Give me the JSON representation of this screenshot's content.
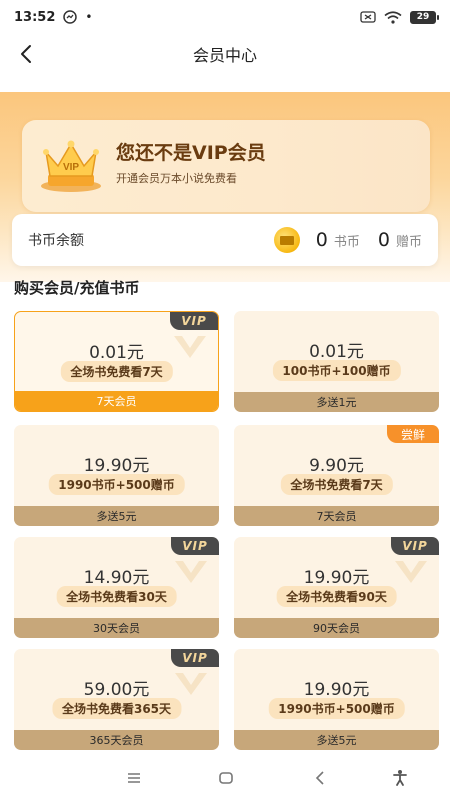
{
  "status_bar": {
    "time": "13:52",
    "dot": "•",
    "battery": "29",
    "icons": [
      "messenger-icon",
      "sim-icon",
      "wifi-icon",
      "battery-icon"
    ]
  },
  "nav": {
    "title": "会员中心",
    "back_icon": "chevron-left-icon"
  },
  "vip_banner": {
    "title": "您还不是VIP会员",
    "subtitle": "开通会员万本小说免费看",
    "crown_text": "VIP"
  },
  "balance": {
    "label": "书币余额",
    "coins": "0",
    "coins_unit": "书币",
    "gift": "0",
    "gift_unit": "赠币"
  },
  "section_title": "购买会员/充值书币",
  "products": [
    {
      "price": "0.01元",
      "desc": "全场书免费看7天",
      "footer": "7天会员",
      "tag": "VIP",
      "selected": true
    },
    {
      "price": "0.01元",
      "desc": "100书币+100赠币",
      "footer": "多送1元",
      "tag": "",
      "selected": false
    },
    {
      "price": "19.90元",
      "desc": "1990书币+500赠币",
      "footer": "多送5元",
      "tag": "",
      "selected": false
    },
    {
      "price": "9.90元",
      "desc": "全场书免费看7天",
      "footer": "7天会员",
      "tag": "尝鲜",
      "selected": false
    },
    {
      "price": "14.90元",
      "desc": "全场书免费看30天",
      "footer": "30天会员",
      "tag": "VIP",
      "selected": false
    },
    {
      "price": "19.90元",
      "desc": "全场书免费看90天",
      "footer": "90天会员",
      "tag": "VIP",
      "selected": false
    },
    {
      "price": "59.00元",
      "desc": "全场书免费看365天",
      "footer": "365天会员",
      "tag": "VIP",
      "selected": false
    },
    {
      "price": "19.90元",
      "desc": "1990书币+500赠币",
      "footer": "多送5元",
      "tag": "",
      "selected": false
    }
  ],
  "colors": {
    "accent": "#f7a21a",
    "banner_top": "#fbc67d",
    "card_bg": "#fdf3e4",
    "footer_bg": "#c7a77a",
    "vip_tag_bg": "#4a4a4a",
    "taste_tag_bg": "#f7912a"
  },
  "system_nav": [
    "menu-icon",
    "home-icon",
    "back-icon",
    "accessibility-icon"
  ]
}
